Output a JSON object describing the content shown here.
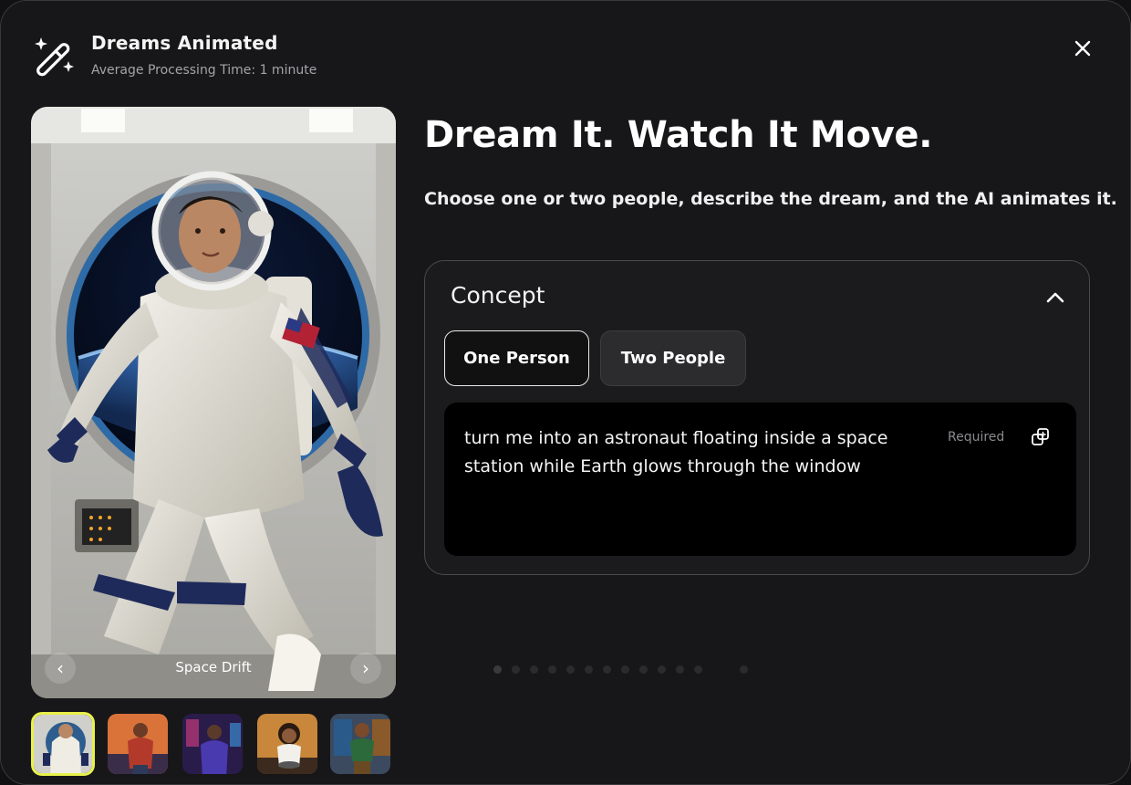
{
  "header": {
    "title": "Dreams Animated",
    "subtitle": "Average Processing Time: 1 minute",
    "icon": "magic-wand-sparkles-icon",
    "close_icon": "close-icon"
  },
  "preview": {
    "caption": "Space Drift",
    "prev_icon": "‹",
    "next_icon": "›"
  },
  "thumbnails": [
    {
      "name": "Space Drift",
      "colors": [
        "#2d5d8e",
        "#d8d8d4"
      ],
      "selected": true
    },
    {
      "name": "thumb-2",
      "colors": [
        "#d9733a",
        "#3a2d4a"
      ],
      "selected": false
    },
    {
      "name": "thumb-3",
      "colors": [
        "#2a1c4a",
        "#c23b7a"
      ],
      "selected": false
    },
    {
      "name": "thumb-4",
      "colors": [
        "#c8873a",
        "#3b2a1d"
      ],
      "selected": false
    },
    {
      "name": "thumb-5",
      "colors": [
        "#3b4a5e",
        "#2d6a3b"
      ],
      "selected": false
    }
  ],
  "main": {
    "headline": "Dream It. Watch It Move.",
    "subline": "Choose one or two people, describe the dream, and the AI animates it."
  },
  "concept": {
    "title": "Concept",
    "options": [
      "One Person",
      "Two People"
    ],
    "selected_option": "One Person",
    "prompt_text": "turn me into an astronaut floating inside a space station while Earth glows through the window",
    "required_label": "Required",
    "copy_icon": "copy-icon",
    "collapse_icon": "chevron-up-icon"
  },
  "colors": {
    "background": "#1c1c1e",
    "accent_selected_thumb": "#e8f04a",
    "text_primary": "#ffffff",
    "text_muted": "#a4a4a8"
  }
}
